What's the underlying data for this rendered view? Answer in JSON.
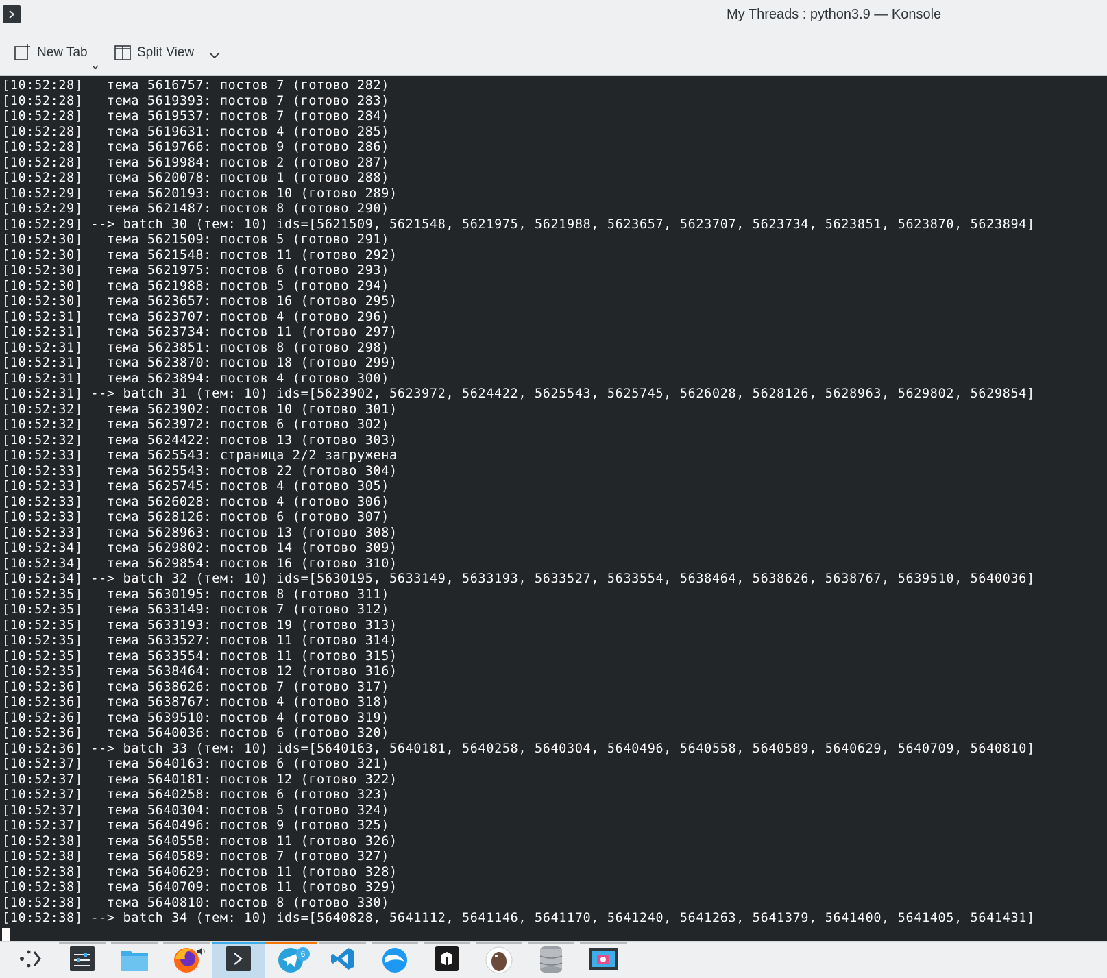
{
  "window": {
    "title": "My Threads : python3.9 — Konsole"
  },
  "toolbar": {
    "new_tab_label": "New Tab",
    "split_view_label": "Split View"
  },
  "terminal": {
    "lines": [
      "[10:52:28]   тема 5616757: постов 7 (готово 282)",
      "[10:52:28]   тема 5619393: постов 7 (готово 283)",
      "[10:52:28]   тема 5619537: постов 7 (готово 284)",
      "[10:52:28]   тема 5619631: постов 4 (готово 285)",
      "[10:52:28]   тема 5619766: постов 9 (готово 286)",
      "[10:52:28]   тема 5619984: постов 2 (готово 287)",
      "[10:52:28]   тема 5620078: постов 1 (готово 288)",
      "[10:52:29]   тема 5620193: постов 10 (готово 289)",
      "[10:52:29]   тема 5621487: постов 8 (готово 290)",
      "[10:52:29] --> batch 30 (тем: 10) ids=[5621509, 5621548, 5621975, 5621988, 5623657, 5623707, 5623734, 5623851, 5623870, 5623894]",
      "[10:52:30]   тема 5621509: постов 5 (готово 291)",
      "[10:52:30]   тема 5621548: постов 11 (готово 292)",
      "[10:52:30]   тема 5621975: постов 6 (готово 293)",
      "[10:52:30]   тема 5621988: постов 5 (готово 294)",
      "[10:52:30]   тема 5623657: постов 16 (готово 295)",
      "[10:52:31]   тема 5623707: постов 4 (готово 296)",
      "[10:52:31]   тема 5623734: постов 11 (готово 297)",
      "[10:52:31]   тема 5623851: постов 8 (готово 298)",
      "[10:52:31]   тема 5623870: постов 18 (готово 299)",
      "[10:52:31]   тема 5623894: постов 4 (готово 300)",
      "[10:52:31] --> batch 31 (тем: 10) ids=[5623902, 5623972, 5624422, 5625543, 5625745, 5626028, 5628126, 5628963, 5629802, 5629854]",
      "[10:52:32]   тема 5623902: постов 10 (готово 301)",
      "[10:52:32]   тема 5623972: постов 6 (готово 302)",
      "[10:52:32]   тема 5624422: постов 13 (готово 303)",
      "[10:52:33]   тема 5625543: страница 2/2 загружена",
      "[10:52:33]   тема 5625543: постов 22 (готово 304)",
      "[10:52:33]   тема 5625745: постов 4 (готово 305)",
      "[10:52:33]   тема 5626028: постов 4 (готово 306)",
      "[10:52:33]   тема 5628126: постов 6 (готово 307)",
      "[10:52:33]   тема 5628963: постов 13 (готово 308)",
      "[10:52:34]   тема 5629802: постов 14 (готово 309)",
      "[10:52:34]   тема 5629854: постов 16 (готово 310)",
      "[10:52:34] --> batch 32 (тем: 10) ids=[5630195, 5633149, 5633193, 5633527, 5633554, 5638464, 5638626, 5638767, 5639510, 5640036]",
      "[10:52:35]   тема 5630195: постов 8 (готово 311)",
      "[10:52:35]   тема 5633149: постов 7 (готово 312)",
      "[10:52:35]   тема 5633193: постов 19 (готово 313)",
      "[10:52:35]   тема 5633527: постов 11 (готово 314)",
      "[10:52:35]   тема 5633554: постов 11 (готово 315)",
      "[10:52:35]   тема 5638464: постов 12 (готово 316)",
      "[10:52:36]   тема 5638626: постов 7 (готово 317)",
      "[10:52:36]   тема 5638767: постов 4 (готово 318)",
      "[10:52:36]   тема 5639510: постов 4 (готово 319)",
      "[10:52:36]   тема 5640036: постов 6 (готово 320)",
      "[10:52:36] --> batch 33 (тем: 10) ids=[5640163, 5640181, 5640258, 5640304, 5640496, 5640558, 5640589, 5640629, 5640709, 5640810]",
      "[10:52:37]   тема 5640163: постов 6 (готово 321)",
      "[10:52:37]   тема 5640181: постов 12 (готово 322)",
      "[10:52:37]   тема 5640258: постов 6 (готово 323)",
      "[10:52:37]   тема 5640304: постов 5 (готово 324)",
      "[10:52:37]   тема 5640496: постов 9 (готово 325)",
      "[10:52:38]   тема 5640558: постов 11 (готово 326)",
      "[10:52:38]   тема 5640589: постов 7 (готово 327)",
      "[10:52:38]   тема 5640629: постов 11 (готово 328)",
      "[10:52:38]   тема 5640709: постов 11 (готово 329)",
      "[10:52:38]   тема 5640810: постов 8 (готово 330)",
      "[10:52:38] --> batch 34 (тем: 10) ids=[5640828, 5641112, 5641146, 5641170, 5641240, 5641263, 5641379, 5641400, 5641405, 5641431]"
    ]
  },
  "taskbar": {
    "items": [
      {
        "icon": "app-launcher-icon",
        "state": "normal"
      },
      {
        "icon": "system-settings-icon",
        "state": "open"
      },
      {
        "icon": "file-manager-icon",
        "state": "open"
      },
      {
        "icon": "firefox-icon",
        "state": "open"
      },
      {
        "icon": "konsole-icon",
        "state": "active"
      },
      {
        "icon": "telegram-icon",
        "state": "attention"
      },
      {
        "icon": "vscode-icon",
        "state": "open"
      },
      {
        "icon": "browser-globe-icon",
        "state": "open"
      },
      {
        "icon": "box-app-icon",
        "state": "open"
      },
      {
        "icon": "beaver-icon",
        "state": "open"
      },
      {
        "icon": "database-icon",
        "state": "open"
      },
      {
        "icon": "screenshot-icon",
        "state": "open"
      }
    ],
    "telegram_badge": "6"
  },
  "colors": {
    "terminal_bg": "#232629",
    "terminal_fg": "#fcfcfc",
    "chrome_bg": "#eff0f1",
    "accent": "#3daee9",
    "attention": "#f67400"
  }
}
